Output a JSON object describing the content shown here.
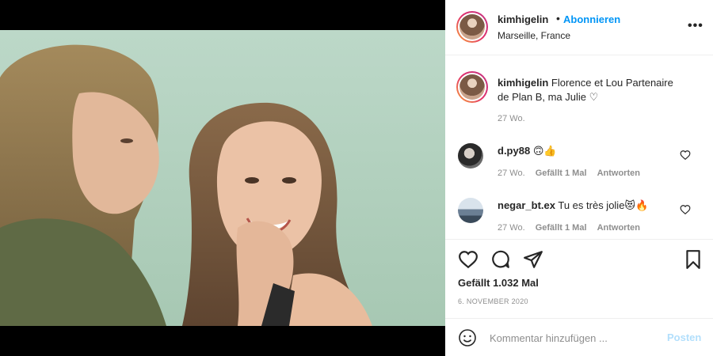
{
  "header": {
    "username": "kimhigelin",
    "separator": "•",
    "follow_label": "Abonnieren",
    "location": "Marseille, France",
    "more_label": "•••"
  },
  "caption": {
    "username": "kimhigelin",
    "text": "Florence et Lou Partenaire de Plan B, ma Julie ♡",
    "time": "27 Wo."
  },
  "comments": [
    {
      "username": "d.py88",
      "text": "🙃👍",
      "time": "27 Wo.",
      "likes": "Gefällt 1 Mal",
      "reply_label": "Antworten"
    },
    {
      "username": "negar_bt.ex",
      "text": "Tu es très jolie😻🔥",
      "time": "27 Wo.",
      "likes": "Gefällt 1 Mal",
      "reply_label": "Antworten"
    }
  ],
  "actions": {
    "likes": "Gefällt 1.032 Mal",
    "date": "6. NOVEMBER 2020"
  },
  "add_comment": {
    "placeholder": "Kommentar hinzufügen ...",
    "post_label": "Posten"
  },
  "icons": [
    "heart-icon",
    "comment-icon",
    "share-icon",
    "bookmark-icon",
    "emoji-icon",
    "more-icon"
  ],
  "colors": {
    "accent": "#0095f6",
    "post_disabled": "#b2dffc",
    "muted_text": "#8e8e8e",
    "text": "#262626"
  }
}
